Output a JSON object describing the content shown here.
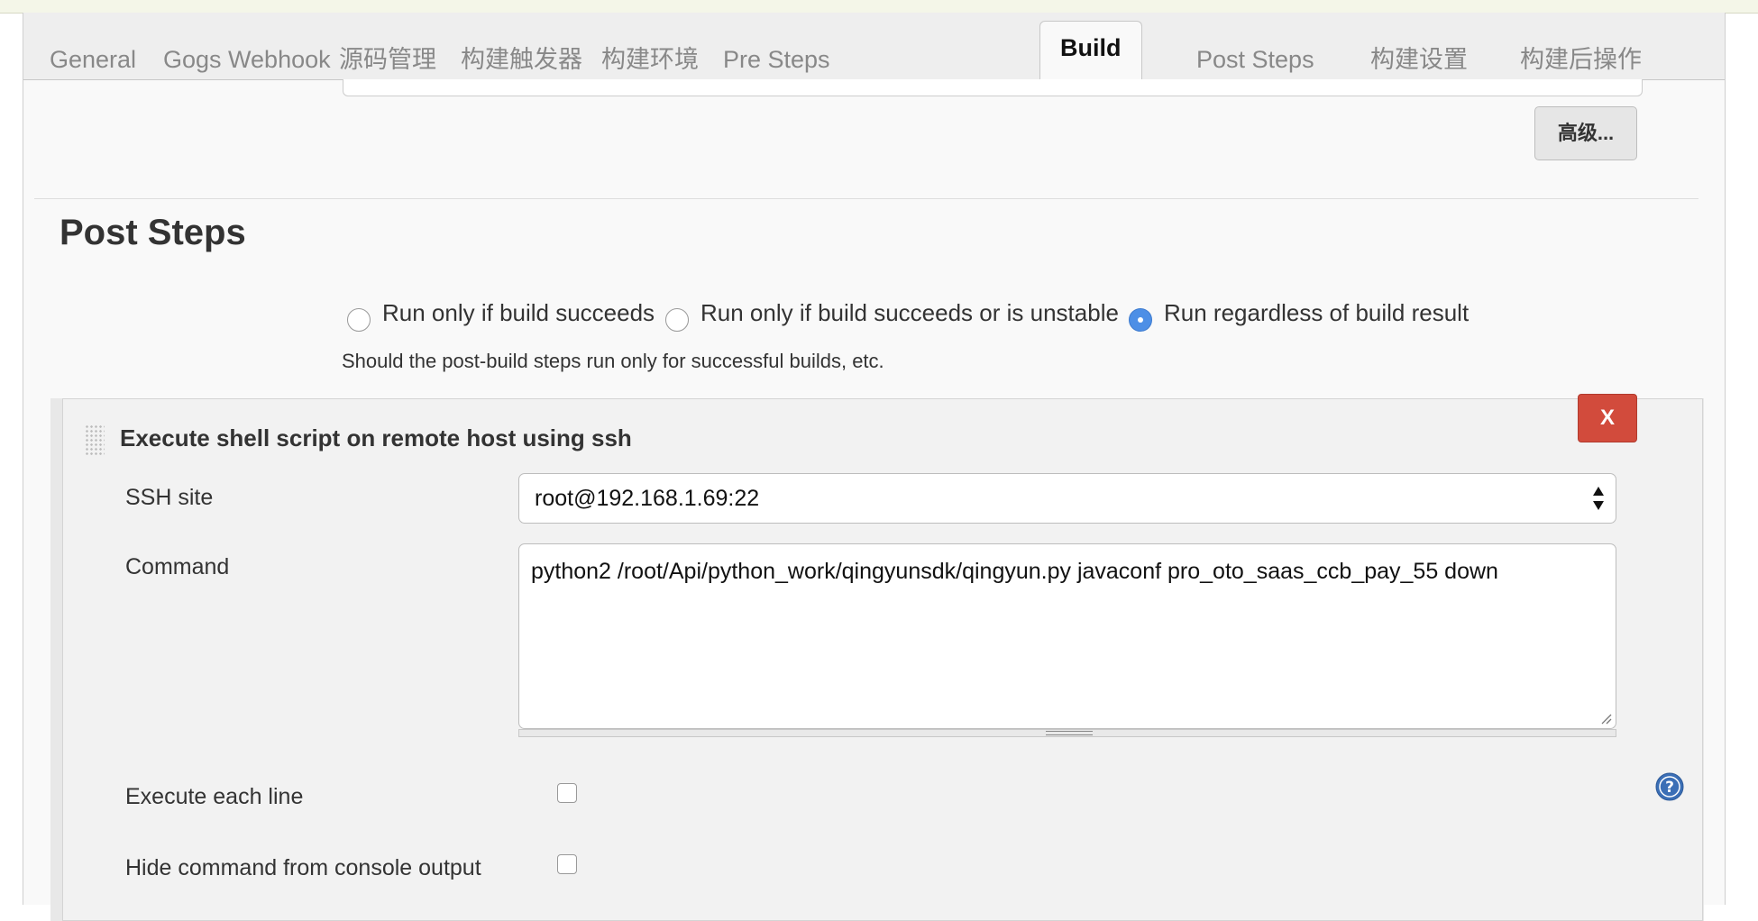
{
  "tabs": [
    {
      "label": "General",
      "active": false
    },
    {
      "label": "Gogs Webhook",
      "active": false
    },
    {
      "label": "源码管理",
      "active": false
    },
    {
      "label": "构建触发器",
      "active": false
    },
    {
      "label": "构建环境",
      "active": false
    },
    {
      "label": "Pre Steps",
      "active": false
    },
    {
      "label": "Build",
      "active": true
    },
    {
      "label": "Post Steps",
      "active": false
    },
    {
      "label": "构建设置",
      "active": false
    },
    {
      "label": "构建后操作",
      "active": false
    }
  ],
  "advanced_button": "高级...",
  "post_steps": {
    "title": "Post Steps",
    "options": [
      {
        "label": "Run only if build succeeds",
        "selected": false
      },
      {
        "label": "Run only if build succeeds or is unstable",
        "selected": false
      },
      {
        "label": "Run regardless of build result",
        "selected": true
      }
    ],
    "help": "Should the post-build steps run only for successful builds, etc."
  },
  "ssh_step": {
    "title": "Execute shell script on remote host using ssh",
    "delete_label": "X",
    "ssh_site_label": "SSH site",
    "ssh_site_value": "root@192.168.1.69:22",
    "command_label": "Command",
    "command_value": "python2 /root/Api/python_work/qingyunsdk/qingyun.py javaconf pro_oto_saas_ccb_pay_55 down",
    "execute_each_line_label": "Execute each line",
    "execute_each_line_checked": false,
    "hide_command_label": "Hide command from console output",
    "hide_command_checked": false
  },
  "colors": {
    "accent": "#4d8fe6",
    "danger": "#d24b3c",
    "help_icon": "#3b6fb6"
  },
  "icons": [
    "drag-handle-icon",
    "select-arrows-icon",
    "resize-corner-icon",
    "help-icon"
  ]
}
